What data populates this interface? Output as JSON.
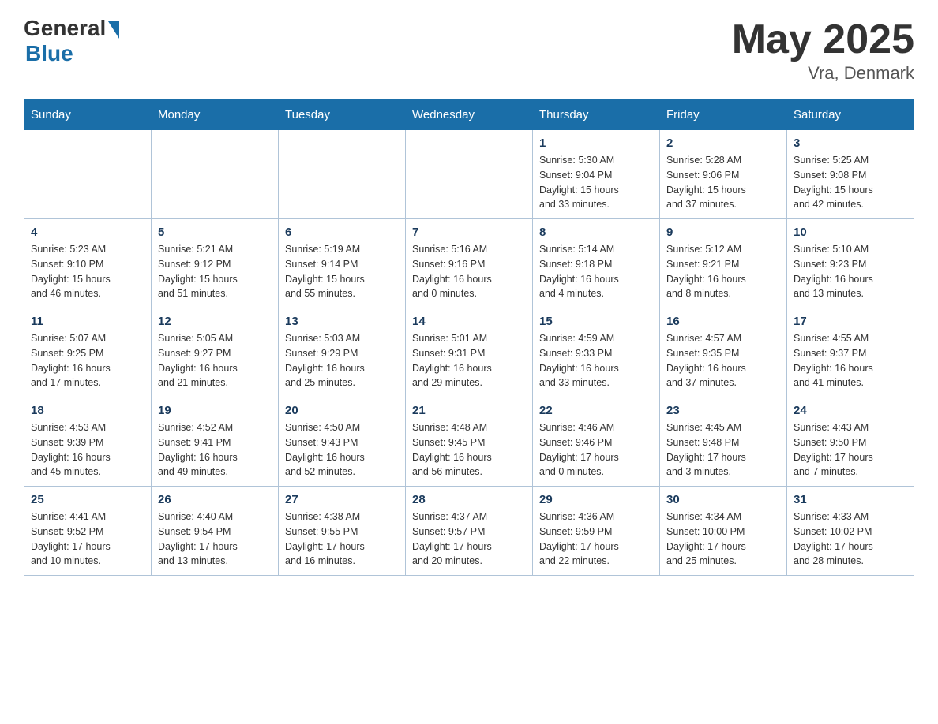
{
  "header": {
    "logo_general": "General",
    "logo_blue": "Blue",
    "title": "May 2025",
    "location": "Vra, Denmark"
  },
  "weekdays": [
    "Sunday",
    "Monday",
    "Tuesday",
    "Wednesday",
    "Thursday",
    "Friday",
    "Saturday"
  ],
  "weeks": [
    [
      {
        "day": "",
        "info": ""
      },
      {
        "day": "",
        "info": ""
      },
      {
        "day": "",
        "info": ""
      },
      {
        "day": "",
        "info": ""
      },
      {
        "day": "1",
        "info": "Sunrise: 5:30 AM\nSunset: 9:04 PM\nDaylight: 15 hours\nand 33 minutes."
      },
      {
        "day": "2",
        "info": "Sunrise: 5:28 AM\nSunset: 9:06 PM\nDaylight: 15 hours\nand 37 minutes."
      },
      {
        "day": "3",
        "info": "Sunrise: 5:25 AM\nSunset: 9:08 PM\nDaylight: 15 hours\nand 42 minutes."
      }
    ],
    [
      {
        "day": "4",
        "info": "Sunrise: 5:23 AM\nSunset: 9:10 PM\nDaylight: 15 hours\nand 46 minutes."
      },
      {
        "day": "5",
        "info": "Sunrise: 5:21 AM\nSunset: 9:12 PM\nDaylight: 15 hours\nand 51 minutes."
      },
      {
        "day": "6",
        "info": "Sunrise: 5:19 AM\nSunset: 9:14 PM\nDaylight: 15 hours\nand 55 minutes."
      },
      {
        "day": "7",
        "info": "Sunrise: 5:16 AM\nSunset: 9:16 PM\nDaylight: 16 hours\nand 0 minutes."
      },
      {
        "day": "8",
        "info": "Sunrise: 5:14 AM\nSunset: 9:18 PM\nDaylight: 16 hours\nand 4 minutes."
      },
      {
        "day": "9",
        "info": "Sunrise: 5:12 AM\nSunset: 9:21 PM\nDaylight: 16 hours\nand 8 minutes."
      },
      {
        "day": "10",
        "info": "Sunrise: 5:10 AM\nSunset: 9:23 PM\nDaylight: 16 hours\nand 13 minutes."
      }
    ],
    [
      {
        "day": "11",
        "info": "Sunrise: 5:07 AM\nSunset: 9:25 PM\nDaylight: 16 hours\nand 17 minutes."
      },
      {
        "day": "12",
        "info": "Sunrise: 5:05 AM\nSunset: 9:27 PM\nDaylight: 16 hours\nand 21 minutes."
      },
      {
        "day": "13",
        "info": "Sunrise: 5:03 AM\nSunset: 9:29 PM\nDaylight: 16 hours\nand 25 minutes."
      },
      {
        "day": "14",
        "info": "Sunrise: 5:01 AM\nSunset: 9:31 PM\nDaylight: 16 hours\nand 29 minutes."
      },
      {
        "day": "15",
        "info": "Sunrise: 4:59 AM\nSunset: 9:33 PM\nDaylight: 16 hours\nand 33 minutes."
      },
      {
        "day": "16",
        "info": "Sunrise: 4:57 AM\nSunset: 9:35 PM\nDaylight: 16 hours\nand 37 minutes."
      },
      {
        "day": "17",
        "info": "Sunrise: 4:55 AM\nSunset: 9:37 PM\nDaylight: 16 hours\nand 41 minutes."
      }
    ],
    [
      {
        "day": "18",
        "info": "Sunrise: 4:53 AM\nSunset: 9:39 PM\nDaylight: 16 hours\nand 45 minutes."
      },
      {
        "day": "19",
        "info": "Sunrise: 4:52 AM\nSunset: 9:41 PM\nDaylight: 16 hours\nand 49 minutes."
      },
      {
        "day": "20",
        "info": "Sunrise: 4:50 AM\nSunset: 9:43 PM\nDaylight: 16 hours\nand 52 minutes."
      },
      {
        "day": "21",
        "info": "Sunrise: 4:48 AM\nSunset: 9:45 PM\nDaylight: 16 hours\nand 56 minutes."
      },
      {
        "day": "22",
        "info": "Sunrise: 4:46 AM\nSunset: 9:46 PM\nDaylight: 17 hours\nand 0 minutes."
      },
      {
        "day": "23",
        "info": "Sunrise: 4:45 AM\nSunset: 9:48 PM\nDaylight: 17 hours\nand 3 minutes."
      },
      {
        "day": "24",
        "info": "Sunrise: 4:43 AM\nSunset: 9:50 PM\nDaylight: 17 hours\nand 7 minutes."
      }
    ],
    [
      {
        "day": "25",
        "info": "Sunrise: 4:41 AM\nSunset: 9:52 PM\nDaylight: 17 hours\nand 10 minutes."
      },
      {
        "day": "26",
        "info": "Sunrise: 4:40 AM\nSunset: 9:54 PM\nDaylight: 17 hours\nand 13 minutes."
      },
      {
        "day": "27",
        "info": "Sunrise: 4:38 AM\nSunset: 9:55 PM\nDaylight: 17 hours\nand 16 minutes."
      },
      {
        "day": "28",
        "info": "Sunrise: 4:37 AM\nSunset: 9:57 PM\nDaylight: 17 hours\nand 20 minutes."
      },
      {
        "day": "29",
        "info": "Sunrise: 4:36 AM\nSunset: 9:59 PM\nDaylight: 17 hours\nand 22 minutes."
      },
      {
        "day": "30",
        "info": "Sunrise: 4:34 AM\nSunset: 10:00 PM\nDaylight: 17 hours\nand 25 minutes."
      },
      {
        "day": "31",
        "info": "Sunrise: 4:33 AM\nSunset: 10:02 PM\nDaylight: 17 hours\nand 28 minutes."
      }
    ]
  ]
}
